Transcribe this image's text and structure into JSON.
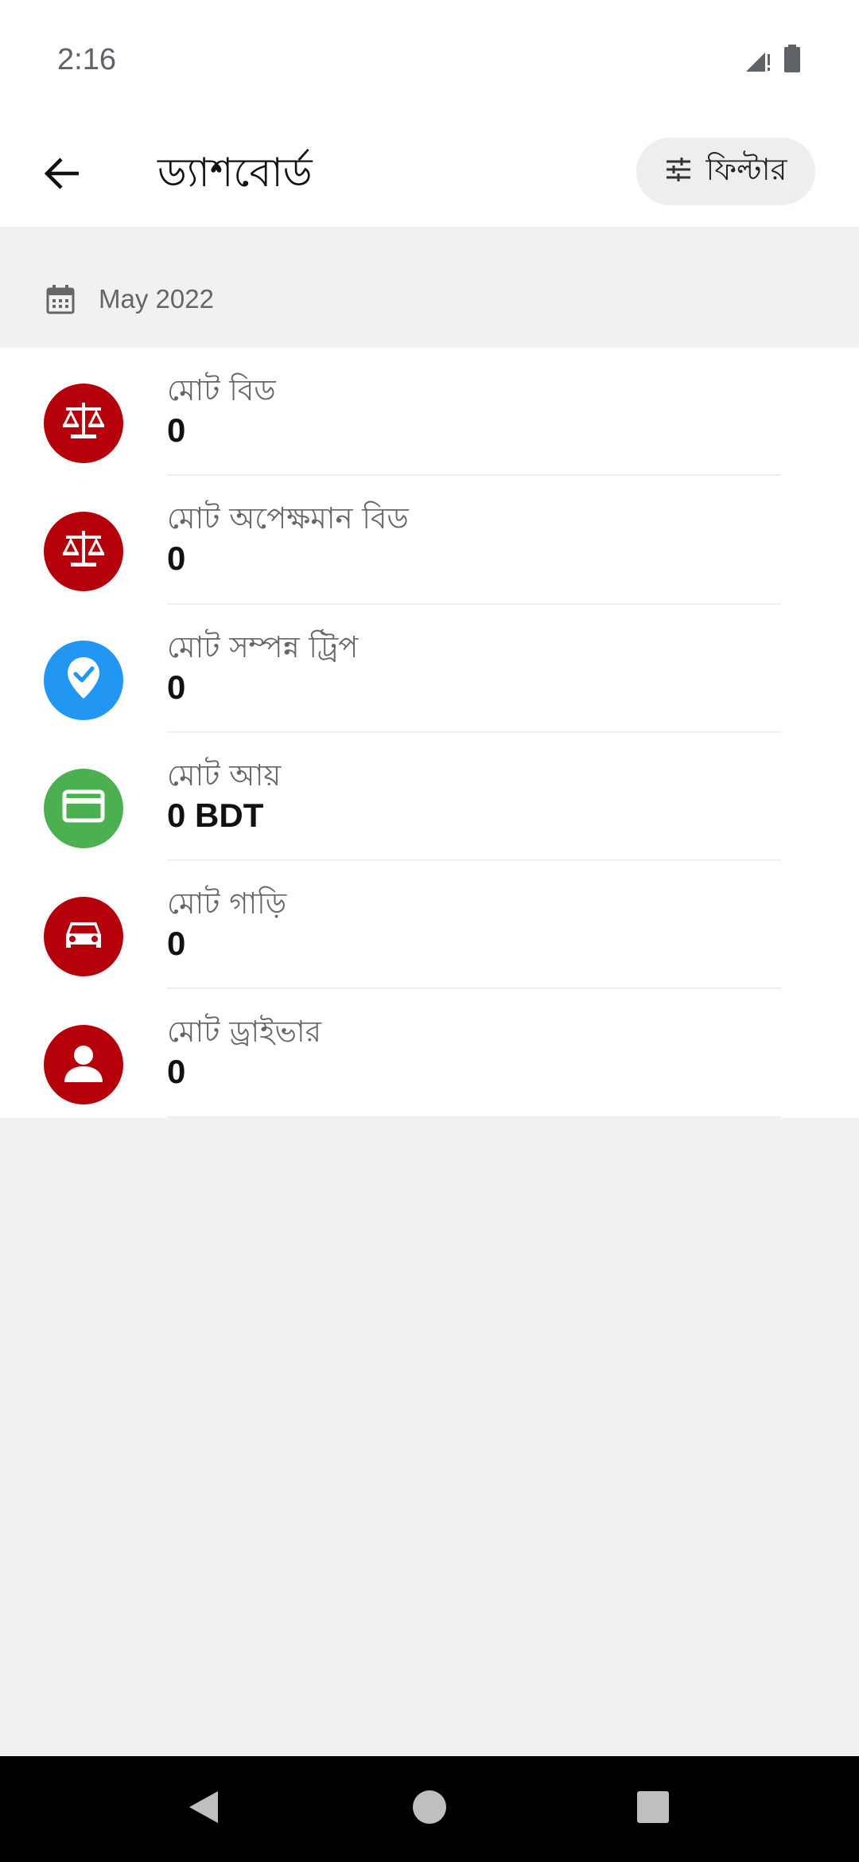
{
  "status_bar": {
    "time": "2:16",
    "icons": [
      "signal-icon",
      "battery-icon"
    ]
  },
  "app_bar": {
    "back_icon": "arrow-left-icon",
    "title": "ড্যাশবোর্ড",
    "filter_label": "ফিল্টার",
    "filter_icon": "tune-icon"
  },
  "date_filter": {
    "icon": "calendar-icon",
    "text": "May 2022"
  },
  "stats": [
    {
      "label": "মোট বিড",
      "value": "0",
      "icon": "scale-icon",
      "color": "#b5000b"
    },
    {
      "label": "মোট অপেক্ষমান বিড",
      "value": "0",
      "icon": "scale-icon",
      "color": "#b5000b"
    },
    {
      "label": "মোট সম্পন্ন ট্রিপ",
      "value": "0",
      "icon": "location-check-icon",
      "color": "#2196f3"
    },
    {
      "label": "মোট আয়",
      "value": "0 BDT",
      "icon": "credit-card-icon",
      "color": "#4caf50"
    },
    {
      "label": "মোট গাড়ি",
      "value": "0",
      "icon": "car-icon",
      "color": "#b5000b"
    },
    {
      "label": "মোট ড্রাইভার",
      "value": "0",
      "icon": "person-icon",
      "color": "#b5000b"
    }
  ],
  "nav_bar": {
    "buttons": [
      "back-nav-icon",
      "home-nav-icon",
      "recents-nav-icon"
    ]
  },
  "colors": {
    "app_background": "#f1f1f1",
    "surface": "#ffffff",
    "brand_red": "#b5000b",
    "blue": "#2196f3",
    "green": "#4caf50"
  }
}
